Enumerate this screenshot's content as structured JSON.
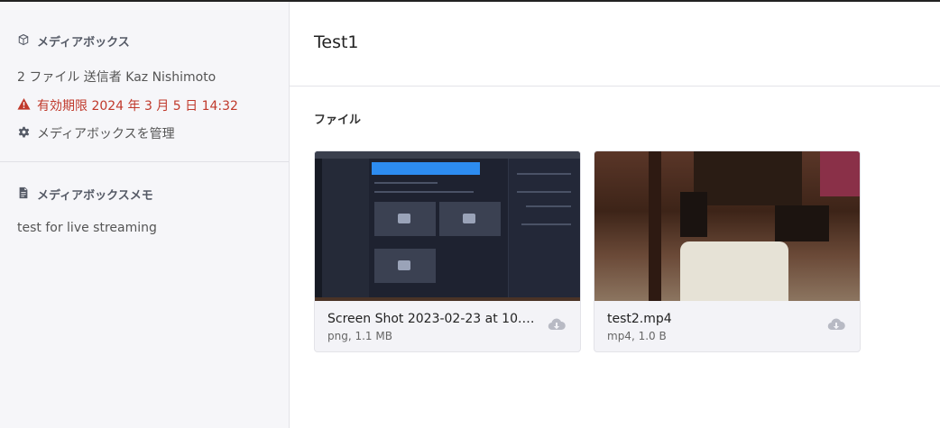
{
  "sidebar": {
    "mediabox_heading": "メディアボックス",
    "files_line": "2 ファイル 送信者 Kaz Nishimoto",
    "expiry_line": "有効期限 2024 年 3 月 5 日 14:32",
    "manage_label": "メディアボックスを管理",
    "memo_heading": "メディアボックスメモ",
    "memo_text": "test for live streaming"
  },
  "main": {
    "title": "Test1",
    "files_heading": "ファイル",
    "files": [
      {
        "name": "Screen Shot 2023-02-23 at 10.4...",
        "meta": "png, 1.1 MB"
      },
      {
        "name": "test2.mp4",
        "meta": "mp4, 1.0 B"
      }
    ]
  },
  "icons": {
    "box": "box-icon",
    "warning": "warning-icon",
    "gear": "gear-icon",
    "memo": "document-icon",
    "download": "cloud-download-icon"
  },
  "colors": {
    "expiry": "#c0392b",
    "sidebar_bg": "#f6f6f9"
  }
}
